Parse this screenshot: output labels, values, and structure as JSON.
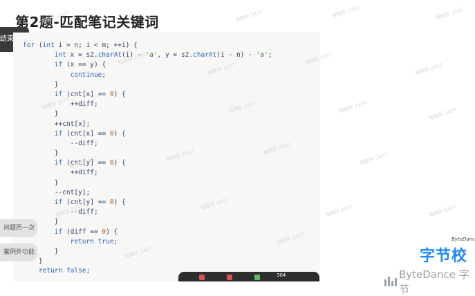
{
  "slide": {
    "title": "第2题-匹配笔记关键词"
  },
  "overlay": {
    "end_label": "结束演示",
    "side_buttons": [
      {
        "label": "问题历一次"
      },
      {
        "label": "案例外功能"
      }
    ]
  },
  "code_lines": [
    "for (int i = n; i < m; ++i) {",
    "        int x = s2.charAt(i) - 'a', y = s2.charAt(i - n) - 'a';",
    "        if (x == y) {",
    "            continue;",
    "        }",
    "        if (cnt[x] == 0) {",
    "            ++diff;",
    "        }",
    "        ++cnt[x];",
    "        if (cnt[x] == 0) {",
    "            --diff;",
    "        }",
    "        if (cnt[y] == 0) {",
    "            ++diff;",
    "        }",
    "        --cnt[y];",
    "        if (cnt[y] == 0) {",
    "            --diff;",
    "        }",
    "        if (diff == 0) {",
    "            return true;",
    "        }",
    "    }",
    "    return false;"
  ],
  "toolbar": {
    "count": "304"
  },
  "brand": {
    "cn_text": "字节校",
    "tag": "ByteDance",
    "logo_text": "ByteDance 字节"
  },
  "watermark": {
    "text": "程晓东 2437"
  }
}
